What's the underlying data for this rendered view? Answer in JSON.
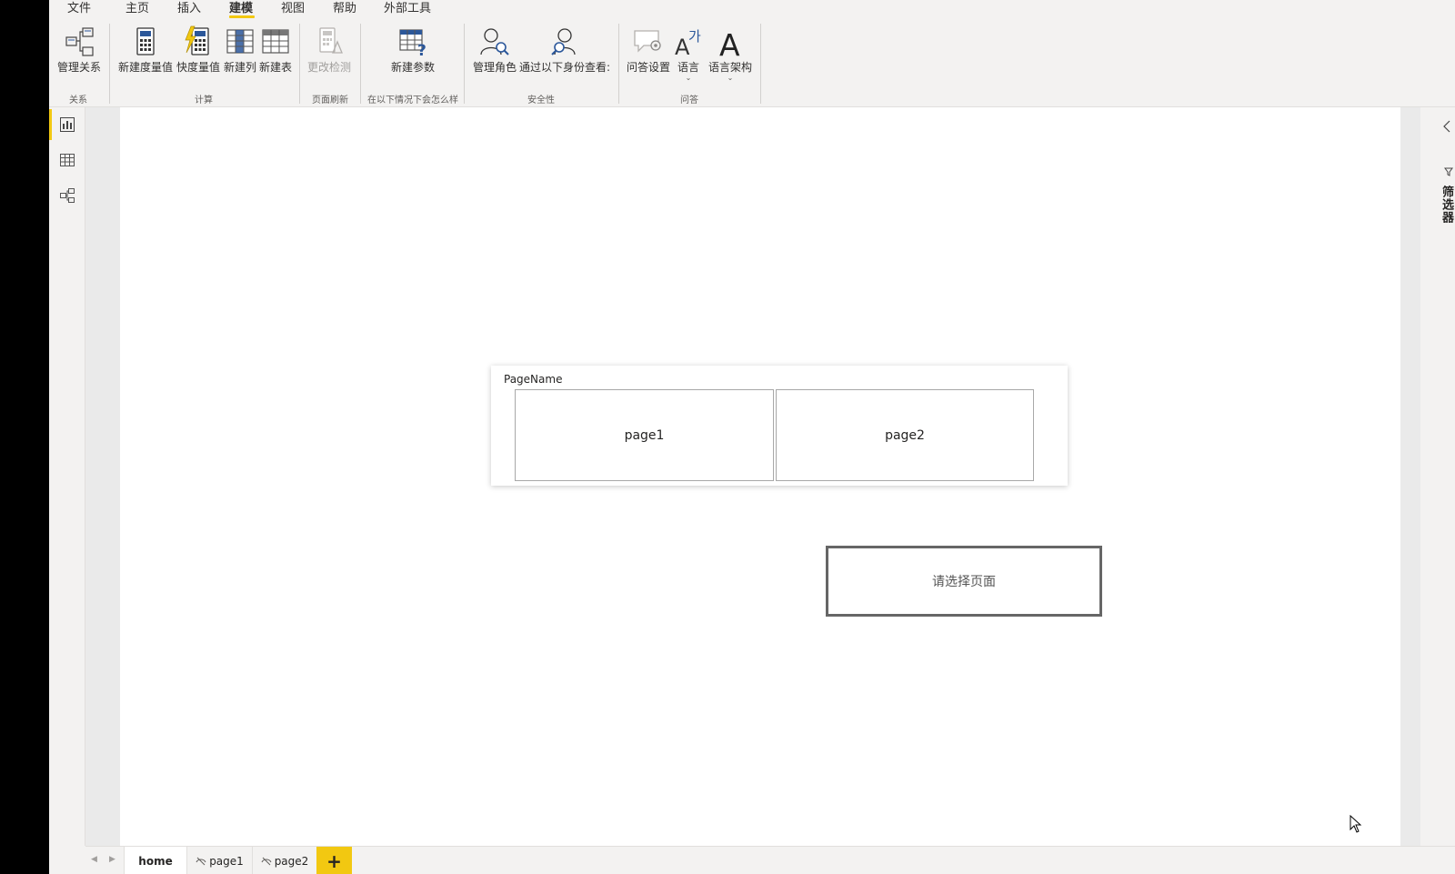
{
  "menu": {
    "tabs": [
      {
        "label": "文件"
      },
      {
        "label": "主页"
      },
      {
        "label": "插入"
      },
      {
        "label": "建模"
      },
      {
        "label": "视图"
      },
      {
        "label": "帮助"
      },
      {
        "label": "外部工具"
      }
    ],
    "active_tab": "建模"
  },
  "ribbon": {
    "manage_relationships": "管理关系",
    "new_measure": "新建度量值",
    "quick_measure": "快度量值",
    "new_column": "新建列",
    "new_table": "新建表",
    "change_detection": "更改检测",
    "new_parameter": "新建参数",
    "manage_roles": "管理角色",
    "view_as": "通过以下身份查看:",
    "qa_setup": "问答设置",
    "language": "语言",
    "linguistic_schema": "语言架构",
    "groups": {
      "relationships": "关系",
      "calculations": "计算",
      "page_refresh": "页面刷新",
      "what_if": "在以下情况下会怎么样",
      "security": "安全性",
      "qa": "问答"
    }
  },
  "canvas": {
    "slicer": {
      "title": "PageName",
      "items": [
        {
          "label": "page1"
        },
        {
          "label": "page2"
        }
      ]
    },
    "nav_button": {
      "label": "请选择页面"
    }
  },
  "right_panel": {
    "filters_label": "筛选器"
  },
  "page_tabs": {
    "tabs": [
      {
        "label": "home",
        "hidden": false,
        "active": true
      },
      {
        "label": "page1",
        "hidden": true,
        "active": false
      },
      {
        "label": "page2",
        "hidden": true,
        "active": false
      }
    ],
    "add_label": "+"
  },
  "colors": {
    "accent": "#f2c811",
    "ribbon_bg": "#f3f2f1",
    "canvas_bg": "#eaeaea",
    "icon_blue": "#2b579a"
  },
  "icons": {
    "left_nav": [
      "report-view-icon",
      "data-view-icon",
      "model-view-icon"
    ]
  }
}
